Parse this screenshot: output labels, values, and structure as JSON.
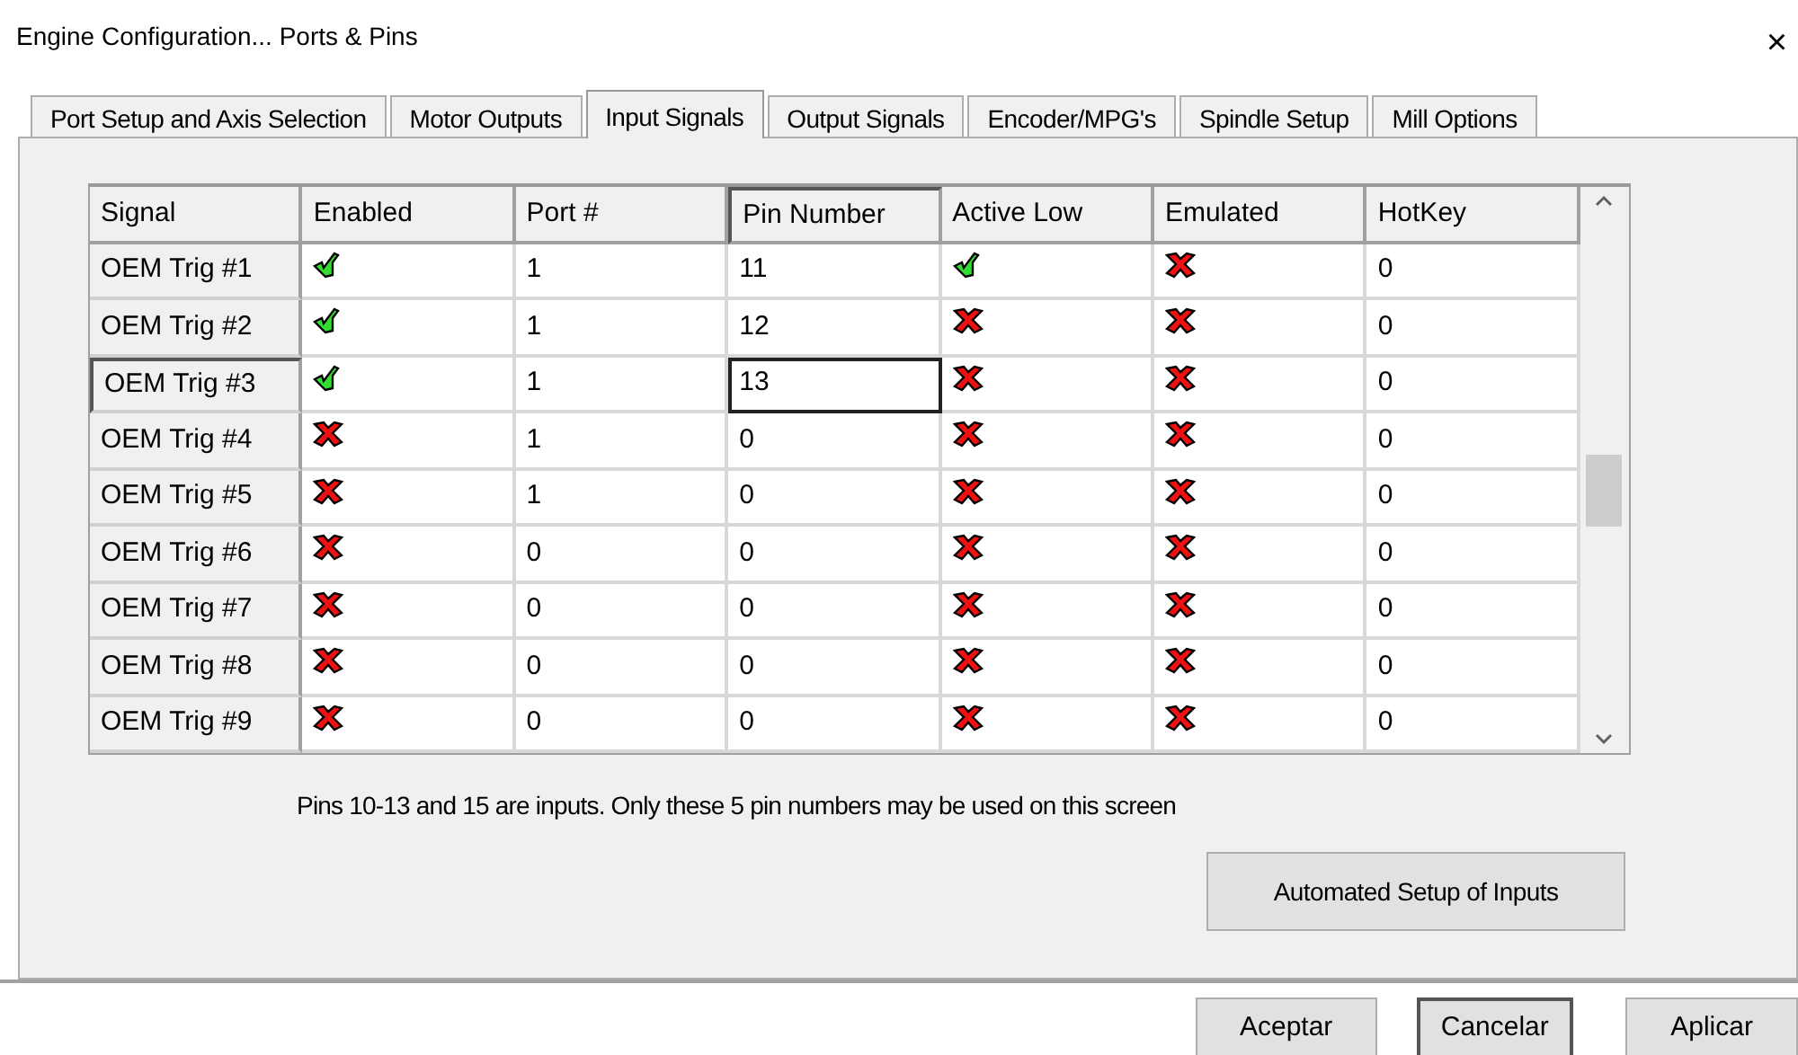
{
  "window": {
    "title": "Engine Configuration... Ports & Pins",
    "close": "×"
  },
  "tabs": [
    {
      "label": "Port Setup and Axis Selection",
      "selected": false
    },
    {
      "label": "Motor Outputs",
      "selected": false
    },
    {
      "label": "Input Signals",
      "selected": true
    },
    {
      "label": "Output Signals",
      "selected": false
    },
    {
      "label": "Encoder/MPG's",
      "selected": false
    },
    {
      "label": "Spindle Setup",
      "selected": false
    },
    {
      "label": "Mill Options",
      "selected": false
    }
  ],
  "table": {
    "columns": [
      "Signal",
      "Enabled",
      "Port #",
      "Pin Number",
      "Active Low",
      "Emulated",
      "HotKey"
    ],
    "rows": [
      {
        "signal": "OEM Trig #1",
        "enabled": true,
        "port": "1",
        "pin": "11",
        "active_low": true,
        "emulated": false,
        "hotkey": "0",
        "selected": false
      },
      {
        "signal": "OEM Trig #2",
        "enabled": true,
        "port": "1",
        "pin": "12",
        "active_low": false,
        "emulated": false,
        "hotkey": "0",
        "selected": false
      },
      {
        "signal": "OEM Trig #3",
        "enabled": true,
        "port": "1",
        "pin": "13",
        "active_low": false,
        "emulated": false,
        "hotkey": "0",
        "selected": true
      },
      {
        "signal": "OEM Trig #4",
        "enabled": false,
        "port": "1",
        "pin": "0",
        "active_low": false,
        "emulated": false,
        "hotkey": "0",
        "selected": false
      },
      {
        "signal": "OEM Trig #5",
        "enabled": false,
        "port": "1",
        "pin": "0",
        "active_low": false,
        "emulated": false,
        "hotkey": "0",
        "selected": false
      },
      {
        "signal": "OEM Trig #6",
        "enabled": false,
        "port": "0",
        "pin": "0",
        "active_low": false,
        "emulated": false,
        "hotkey": "0",
        "selected": false
      },
      {
        "signal": "OEM Trig #7",
        "enabled": false,
        "port": "0",
        "pin": "0",
        "active_low": false,
        "emulated": false,
        "hotkey": "0",
        "selected": false
      },
      {
        "signal": "OEM Trig #8",
        "enabled": false,
        "port": "0",
        "pin": "0",
        "active_low": false,
        "emulated": false,
        "hotkey": "0",
        "selected": false
      },
      {
        "signal": "OEM Trig #9",
        "enabled": false,
        "port": "0",
        "pin": "0",
        "active_low": false,
        "emulated": false,
        "hotkey": "0",
        "selected": false
      }
    ]
  },
  "note": "Pins 10-13 and 15 are inputs. Only these 5 pin numbers may be used on this screen",
  "setup_button": "Automated Setup of Inputs",
  "buttons": [
    "Aceptar",
    "Cancelar",
    "Aplicar"
  ]
}
